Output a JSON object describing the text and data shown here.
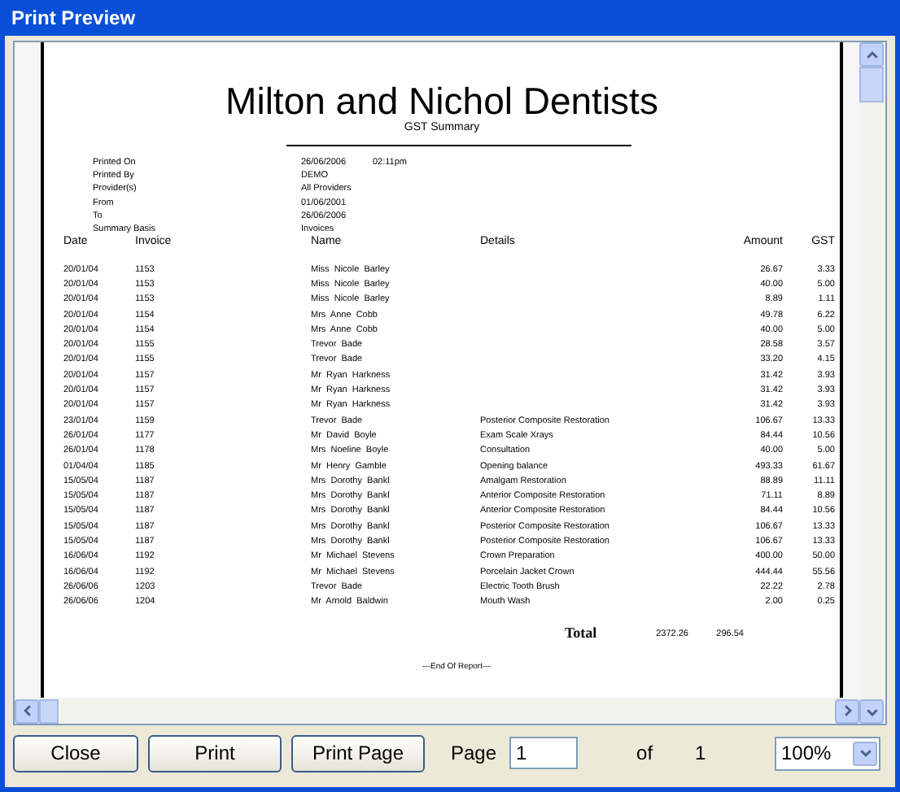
{
  "window": {
    "title": "Print Preview"
  },
  "report": {
    "title": "Milton and Nichol Dentists",
    "subtitle": "GST Summary",
    "meta": [
      {
        "label": "Printed On",
        "value": "26/06/2006",
        "extra": "02:11pm"
      },
      {
        "label": "Printed By",
        "value": "DEMO"
      },
      {
        "label": "Provider(s)",
        "value": "All Providers"
      },
      {
        "label": "From",
        "value": "01/06/2001"
      },
      {
        "label": "To",
        "value": "26/06/2006"
      },
      {
        "label": "Summary Basis",
        "value": "Invoices"
      }
    ],
    "columns": [
      "Date",
      "Invoice",
      "Name",
      "Details",
      "Amount",
      "GST"
    ],
    "rows": [
      [
        "20/01/04",
        "1153",
        "Miss  Nicole  Barley",
        "",
        "26.67",
        "3.33"
      ],
      [
        "20/01/04",
        "1153",
        "Miss  Nicole  Barley",
        "",
        "40.00",
        "5.00"
      ],
      [
        "20/01/04",
        "1153",
        "Miss  Nicole  Barley",
        "",
        "8.89",
        "1.11"
      ],
      [
        "20/01/04",
        "1154",
        "Mrs  Anne  Cobb",
        "",
        "49.78",
        "6.22"
      ],
      [
        "20/01/04",
        "1154",
        "Mrs  Anne  Cobb",
        "",
        "40.00",
        "5.00"
      ],
      [
        "20/01/04",
        "1155",
        "Trevor  Bade",
        "",
        "28.58",
        "3.57"
      ],
      [
        "20/01/04",
        "1155",
        "Trevor  Bade",
        "",
        "33.20",
        "4.15"
      ],
      [
        "20/01/04",
        "1157",
        "Mr  Ryan  Harkness",
        "",
        "31.42",
        "3.93"
      ],
      [
        "20/01/04",
        "1157",
        "Mr  Ryan  Harkness",
        "",
        "31.42",
        "3.93"
      ],
      [
        "20/01/04",
        "1157",
        "Mr  Ryan  Harkness",
        "",
        "31.42",
        "3.93"
      ],
      [
        "23/01/04",
        "1159",
        "Trevor  Bade",
        "Posterior Composite Restoration",
        "106.67",
        "13.33"
      ],
      [
        "26/01/04",
        "1177",
        "Mr  David  Boyle",
        "Exam Scale Xrays",
        "84.44",
        "10.56"
      ],
      [
        "26/01/04",
        "1178",
        "Mrs  Noeline  Boyle",
        "Consultation",
        "40.00",
        "5.00"
      ],
      [
        "01/04/04",
        "1185",
        "Mr  Henry  Gamble",
        "Opening balance",
        "493.33",
        "61.67"
      ],
      [
        "15/05/04",
        "1187",
        "Mrs  Dorothy  Bankl",
        "Amalgam Restoration",
        "88.89",
        "11.11"
      ],
      [
        "15/05/04",
        "1187",
        "Mrs  Dorothy  Bankl",
        "Anterior Composite Restoration",
        "71.11",
        "8.89"
      ],
      [
        "15/05/04",
        "1187",
        "Mrs  Dorothy  Bankl",
        "Anterior Composite Restoration",
        "84.44",
        "10.56"
      ],
      [
        "15/05/04",
        "1187",
        "Mrs  Dorothy  Bankl",
        "Posterior Composite Restoration",
        "106.67",
        "13.33"
      ],
      [
        "15/05/04",
        "1187",
        "Mrs  Dorothy  Bankl",
        "Posterior Composite Restoration",
        "106.67",
        "13.33"
      ],
      [
        "16/06/04",
        "1192",
        "Mr  Michael  Stevens",
        "Crown Preparation",
        "400.00",
        "50.00"
      ],
      [
        "16/06/04",
        "1192",
        "Mr  Michael  Stevens",
        "Porcelain Jacket Crown",
        "444.44",
        "55.56"
      ],
      [
        "26/06/06",
        "1203",
        "Trevor  Bade",
        "Electric Tooth Brush",
        "22.22",
        "2.78"
      ],
      [
        "26/06/06",
        "1204",
        "Mr  Arnold  Baldwin",
        "Mouth Wash",
        "2.00",
        "0.25"
      ]
    ],
    "total": {
      "label": "Total",
      "amount": "2372.26",
      "gst": "296.54"
    },
    "footer": "---End Of Report---"
  },
  "toolbar": {
    "buttons": [
      "Close",
      "Print",
      "Print Page"
    ],
    "page_label": "Page",
    "page_value": "1",
    "of_label": "of",
    "page_count": "1",
    "zoom": "100%"
  }
}
